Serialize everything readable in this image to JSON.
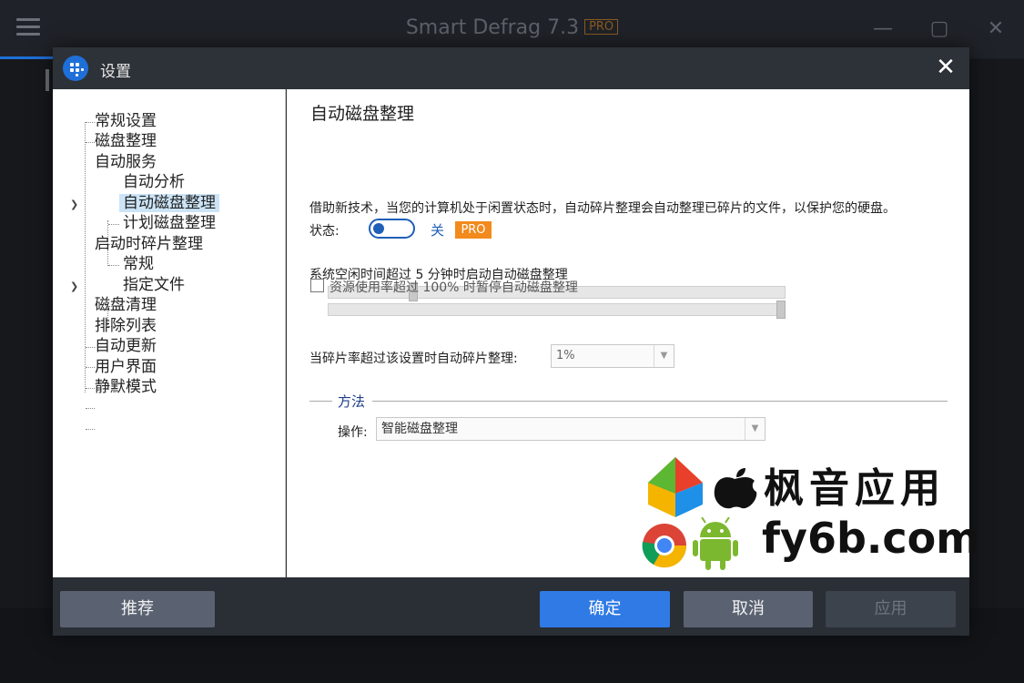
{
  "app": {
    "title": "Smart Defrag 7.3",
    "badge": "PRO",
    "minimize_glyph": "—",
    "maximize_glyph": "▢",
    "close_glyph": "✕"
  },
  "dialog": {
    "title": "设置",
    "close_glyph": "✕"
  },
  "nav": {
    "items": [
      {
        "label": "常规设置"
      },
      {
        "label": "磁盘整理"
      },
      {
        "label": "自动服务"
      },
      {
        "label": "自动分析"
      },
      {
        "label": "自动磁盘整理"
      },
      {
        "label": "计划磁盘整理"
      },
      {
        "label": "启动时碎片整理"
      },
      {
        "label": "常规"
      },
      {
        "label": "指定文件"
      },
      {
        "label": "磁盘清理"
      },
      {
        "label": "排除列表"
      },
      {
        "label": "自动更新"
      },
      {
        "label": "用户界面"
      },
      {
        "label": "静默模式"
      }
    ],
    "selected": "自动磁盘整理"
  },
  "content": {
    "heading": "自动磁盘整理",
    "description": "借助新技术，当您的计算机处于闲置状态时，自动碎片整理会自动整理已碎片的文件，以保护您的硬盘。",
    "status_label": "状态:",
    "toggle_state": "关",
    "pro_badge": "PRO",
    "idle_label": "系统空闲时间超过 5 分钟时启动自动磁盘整理",
    "idle_minutes": 5,
    "resource_label": "资源使用率超过 100% 时暂停自动磁盘整理",
    "resource_percent": 100,
    "fragment_label": "当碎片率超过该设置时自动碎片整理:",
    "fragment_value": "1%",
    "method_group": "方法",
    "operation_label": "操作:",
    "operation_value": "智能磁盘整理"
  },
  "watermark": {
    "cn": "枫音应用",
    "url": "fy6b.com"
  },
  "footer": {
    "recommend": "推荐",
    "ok": "确定",
    "cancel": "取消",
    "apply": "应用"
  },
  "colors": {
    "accent": "#2f7ae5",
    "pro": "#f28a1e",
    "dialog_bg": "#2a2e35"
  }
}
